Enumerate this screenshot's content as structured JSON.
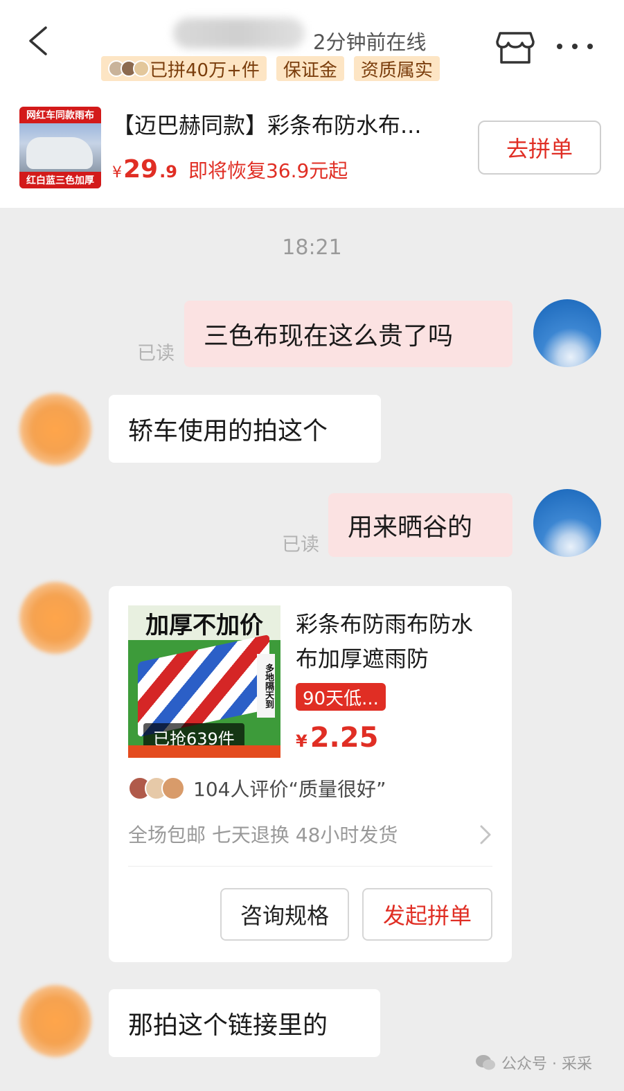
{
  "header": {
    "status": "2分钟前在线",
    "tags": [
      "已拼40万+件",
      "保证金",
      "资质属实"
    ],
    "icons": {
      "back": "chevron-left-icon",
      "store": "store-icon",
      "more": "more-dots-icon"
    }
  },
  "product": {
    "thumb_top_text": "网红车同款雨布",
    "thumb_bottom_text": "红白蓝三色加厚",
    "title": "【迈巴赫同款】彩条布防水布...",
    "price_currency": "¥",
    "price_int": "29",
    "price_dec": ".9",
    "restore_text": "即将恢复36.9元起",
    "button": "去拼单"
  },
  "chat": {
    "time": "18:21",
    "read_label": "已读",
    "messages": [
      {
        "from": "me",
        "text": "三色布现在这么贵了吗"
      },
      {
        "from": "shop",
        "text": "轿车使用的拍这个"
      },
      {
        "from": "me",
        "text": "用来晒谷的"
      },
      {
        "from": "shop",
        "text": "那拍这个链接里的"
      }
    ]
  },
  "card": {
    "image_header": "加厚不加价",
    "image_side": "多地隔天到",
    "sold": "已抢639件",
    "title": "彩条布防雨布防水布加厚遮雨防",
    "low_badge": "90天低...",
    "price_currency": "¥",
    "price": "2.25",
    "reviews": "104人评价“质量很好”",
    "services": "全场包邮 七天退换 48小时发货",
    "btn_spec": "咨询规格",
    "btn_group": "发起拼单"
  },
  "watermark": "公众号 · 采采",
  "colors": {
    "accent": "#e02e24",
    "tag_bg": "#fde5c4",
    "my_bubble": "#fbe2e2",
    "page_bg": "#ededed"
  }
}
